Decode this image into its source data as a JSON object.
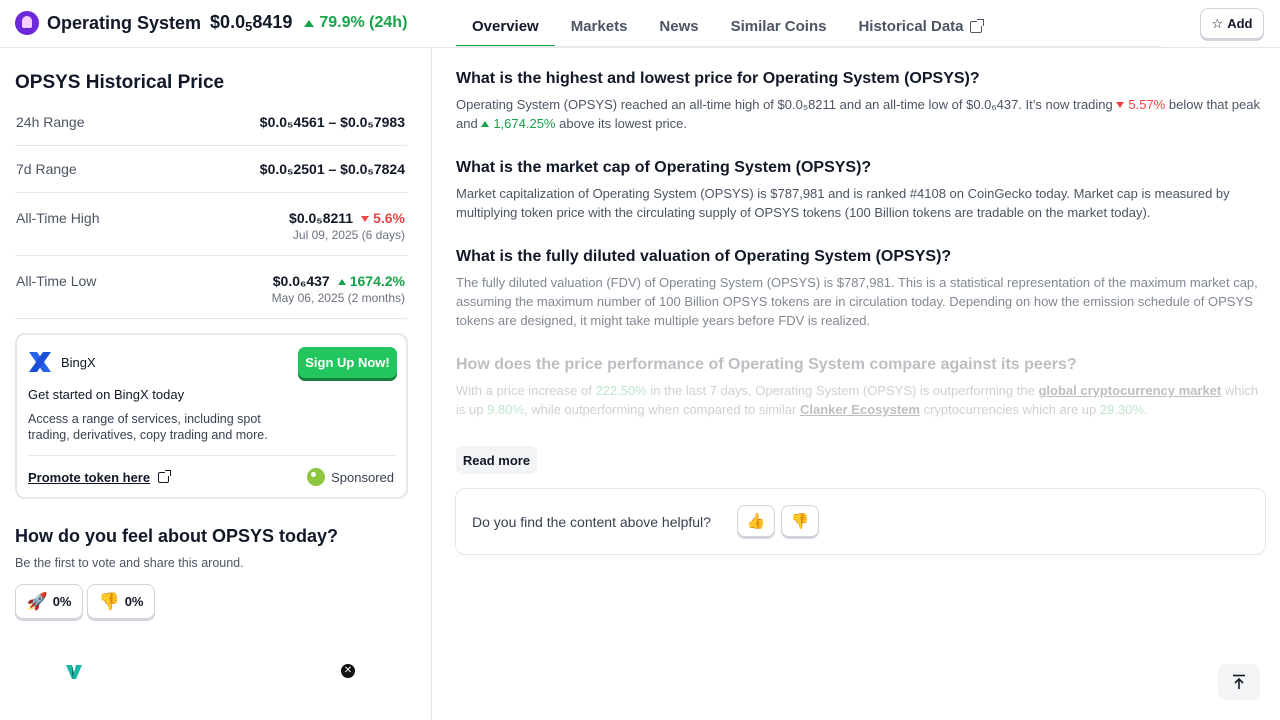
{
  "header": {
    "coin_name": "Operating System",
    "price_prefix": "$0.0",
    "price_sub": "5",
    "price_rest": "8419",
    "change": "79.9% (24h)"
  },
  "tabs": [
    {
      "label": "Overview",
      "active": true
    },
    {
      "label": "Markets"
    },
    {
      "label": "News"
    },
    {
      "label": "Similar Coins"
    },
    {
      "label": "Historical Data"
    }
  ],
  "add_button": {
    "label": "Add",
    "icon": "star-icon"
  },
  "history": {
    "title": "OPSYS Historical Price",
    "rows": [
      {
        "label": "24h Range",
        "value": "$0.0₅4561 – $0.0₅7983"
      },
      {
        "label": "7d Range",
        "value": "$0.0₅2501 – $0.0₅7824"
      },
      {
        "label": "All-Time High",
        "value": "$0.0₅8211",
        "change": "5.6%",
        "date": "Jul 09, 2025 (6 days)"
      },
      {
        "label": "All-Time Low",
        "value": "$0.0₆437",
        "change": "1674.2%",
        "date": "May 06, 2025 (2 months)"
      }
    ]
  },
  "ad": {
    "brand": "BingX",
    "cta": "Sign Up Now!",
    "headline": "Get started on BingX today",
    "description": "Access a range of services, including spot trading, derivatives, copy trading and more.",
    "promote": "Promote token here",
    "sponsored": "Sponsored"
  },
  "sentiment": {
    "title": "How do you feel about OPSYS today?",
    "subtitle": "Be the first to vote and share this around.",
    "bullish": "0%",
    "bearish": "0%"
  },
  "faq": [
    {
      "q": "What is the highest and lowest price for Operating System (OPSYS)?",
      "a_pre": "Operating System (OPSYS) reached an all-time high of $0.0₅8211 and an all-time low of $0.0₆437. It’s now trading",
      "a_down": "5.57%",
      "a_mid": "below that peak and",
      "a_up": "1,674.25%",
      "a_post": "above its lowest price."
    },
    {
      "q": "What is the market cap of Operating System (OPSYS)?",
      "a": "Market capitalization of Operating System (OPSYS) is $787,981 and is ranked #4108 on CoinGecko today. Market cap is measured by multiplying token price with the circulating supply of OPSYS tokens (100 Billion tokens are tradable on the market today)."
    },
    {
      "q": "What is the fully diluted valuation of Operating System (OPSYS)?",
      "a": "The fully diluted valuation (FDV) of Operating System (OPSYS) is $787,981. This is a statistical representation of the maximum market cap, assuming the maximum number of 100 Billion OPSYS tokens are in circulation today. Depending on how the emission schedule of OPSYS tokens are designed, it might take multiple years before FDV is realized."
    },
    {
      "q": "How does the price performance of Operating System compare against its peers?",
      "a_1": "With a price increase of",
      "a_pct1": "222.50%",
      "a_2": "in the last 7 days, Operating System (OPSYS) is outperforming the",
      "a_link1": "global cryptocurrency market",
      "a_3": "which is up",
      "a_pct2": "9.80%",
      "a_4": ", while outperforming when compared to similar",
      "a_link2": "Clanker Ecosystem",
      "a_5": "cryptocurrencies which are up",
      "a_pct3": "29.30%",
      "a_6": "."
    }
  ],
  "read_more": "Read more",
  "feedback": {
    "question": "Do you find the content above helpful?",
    "yes": "👍",
    "no": "👎"
  },
  "colors": {
    "accent": "#16a34a",
    "down": "#ef4444",
    "signup": "#22c55e",
    "logo": "#6d28d9"
  }
}
